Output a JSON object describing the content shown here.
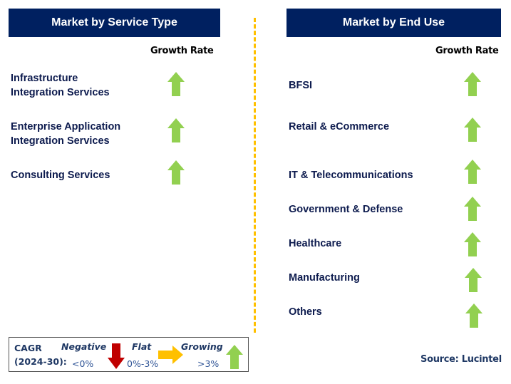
{
  "left_panel": {
    "title": "Market by Service Type",
    "growth_label": "Growth Rate",
    "items": [
      {
        "label_lines": [
          "Infrastructure",
          "Integration Services"
        ],
        "trend": "growing"
      },
      {
        "label_lines": [
          "Enterprise Application",
          "Integration Services"
        ],
        "trend": "growing"
      },
      {
        "label_lines": [
          "Consulting Services"
        ],
        "trend": "growing"
      }
    ]
  },
  "right_panel": {
    "title": "Market by End Use",
    "growth_label": "Growth Rate",
    "items": [
      {
        "label": "BFSI",
        "trend": "growing"
      },
      {
        "label": "Retail & eCommerce",
        "trend": "growing"
      },
      {
        "label": "IT & Telecommunications",
        "trend": "growing"
      },
      {
        "label": "Government & Defense",
        "trend": "growing"
      },
      {
        "label": "Healthcare",
        "trend": "growing"
      },
      {
        "label": "Manufacturing",
        "trend": "growing"
      },
      {
        "label": "Others",
        "trend": "growing"
      }
    ]
  },
  "legend": {
    "cagr_line1": "CAGR",
    "cagr_line2": "(2024-30):",
    "negative": {
      "label": "Negative",
      "range": "<0%",
      "icon": "arrow-down-icon",
      "color": "#c00000"
    },
    "flat": {
      "label": "Flat",
      "range": "0%-3%",
      "icon": "arrow-right-icon",
      "color": "#ffc000"
    },
    "growing": {
      "label": "Growing",
      "range": ">3%",
      "icon": "arrow-up-icon",
      "color": "#92d050"
    }
  },
  "source": "Source: Lucintel",
  "colors": {
    "header_bg": "#002060",
    "divider": "#ffc000",
    "growing": "#92d050"
  }
}
